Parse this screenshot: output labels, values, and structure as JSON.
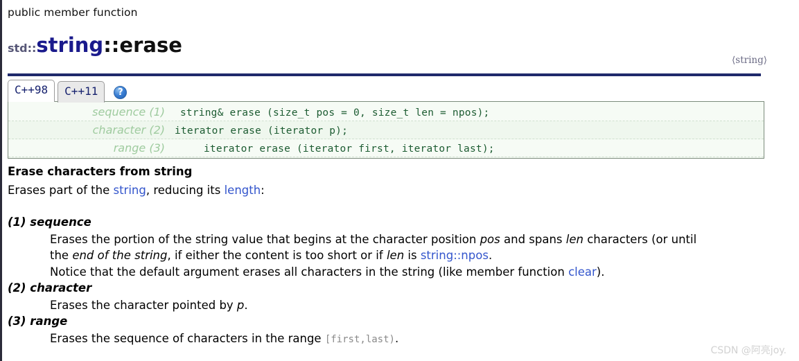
{
  "header": {
    "kind": "public member function",
    "namespace": "std::",
    "class": "string",
    "scope": "::",
    "function": "erase",
    "include": "⟨string⟩"
  },
  "tabs": [
    {
      "label": "C++98",
      "active": true
    },
    {
      "label": "C++11",
      "active": false
    }
  ],
  "help_icon": "?",
  "signatures": [
    {
      "label": "sequence (1)",
      "code": "string& erase (size_t pos = 0, size_t len = npos);"
    },
    {
      "label": "character (2)",
      "code": "iterator erase (iterator p);"
    },
    {
      "label": "range (3)",
      "code": "iterator erase (iterator first, iterator last);"
    }
  ],
  "description": {
    "title": "Erase characters from string",
    "intro_pre": "Erases part of the ",
    "intro_link1": "string",
    "intro_mid": ", reducing its ",
    "intro_link2": "length",
    "intro_post": ":"
  },
  "variants": [
    {
      "head": "(1) sequence",
      "lines": [
        {
          "parts": [
            {
              "t": "Erases the portion of the string value that begins at the character position ",
              "s": "plain"
            },
            {
              "t": "pos",
              "s": "italic"
            },
            {
              "t": " and spans ",
              "s": "plain"
            },
            {
              "t": "len",
              "s": "italic"
            },
            {
              "t": " characters (or until",
              "s": "plain"
            }
          ]
        },
        {
          "parts": [
            {
              "t": "the ",
              "s": "plain"
            },
            {
              "t": "end of the string",
              "s": "italic"
            },
            {
              "t": ", if either the content is too short or if ",
              "s": "plain"
            },
            {
              "t": "len",
              "s": "italic"
            },
            {
              "t": " is ",
              "s": "plain"
            },
            {
              "t": "string::npos",
              "s": "link"
            },
            {
              "t": ".",
              "s": "plain"
            }
          ]
        },
        {
          "parts": [
            {
              "t": "Notice that the default argument erases all characters in the string (like member function ",
              "s": "plain"
            },
            {
              "t": "clear",
              "s": "link"
            },
            {
              "t": ").",
              "s": "plain"
            }
          ]
        }
      ]
    },
    {
      "head": "(2) character",
      "lines": [
        {
          "parts": [
            {
              "t": "Erases the character pointed by ",
              "s": "plain"
            },
            {
              "t": "p",
              "s": "italic"
            },
            {
              "t": ".",
              "s": "plain"
            }
          ]
        }
      ]
    },
    {
      "head": "(3) range",
      "lines": [
        {
          "parts": [
            {
              "t": "Erases the sequence of characters in the range ",
              "s": "plain"
            },
            {
              "t": "[first,last)",
              "s": "mono-gray"
            },
            {
              "t": ".",
              "s": "plain"
            }
          ]
        }
      ]
    }
  ],
  "watermark": "CSDN @阿亮joy.",
  "colors": {
    "rule": "#1f2a6b",
    "class_name": "#1a1a8c",
    "link": "#3355cc",
    "signature_code": "#1d5c32",
    "signature_label": "#9fcb9f",
    "signature_bg": "#f6fbf5",
    "watermark": "#d2d2d2"
  }
}
